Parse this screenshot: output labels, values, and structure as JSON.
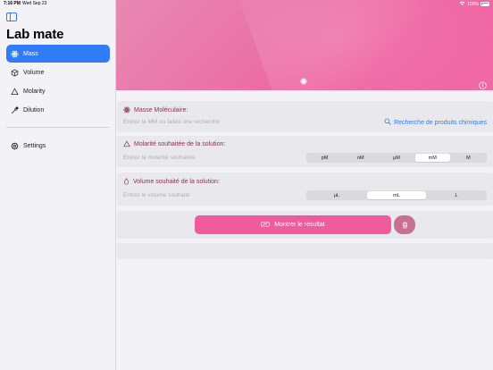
{
  "statusbar": {
    "time": "7:16 PM",
    "date": "Wed Sep 23",
    "battery": "100%"
  },
  "sidebar": {
    "title": "Lab mate",
    "items": [
      {
        "label": "Mass",
        "icon": "atom-icon",
        "active": true
      },
      {
        "label": "Volume",
        "icon": "cube-icon",
        "active": false
      },
      {
        "label": "Molarity",
        "icon": "triangle-icon",
        "active": false
      },
      {
        "label": "Dilution",
        "icon": "dropper-icon",
        "active": false
      }
    ],
    "settings_label": "Settings"
  },
  "mass_card": {
    "title": "Masse Moléculaire:",
    "placeholder": "Entrez la MM ou faites une recherche",
    "search_label": "Recherche de produits chimiques"
  },
  "molarity_card": {
    "title": "Molarité souhaitée de la solution:",
    "placeholder": "Entrez la molarité souhaitée",
    "units": [
      "pM",
      "nM",
      "µM",
      "mM",
      "M"
    ],
    "selected": "mM"
  },
  "volume_card": {
    "title": "Volume souhaité de la solution:",
    "placeholder": "Entrez le volume souhaité",
    "units": [
      "µL",
      "mL",
      "L"
    ],
    "selected": "mL"
  },
  "actions": {
    "show_result_label": "Montrer le résultat"
  },
  "colors": {
    "accent_blue": "#2f7cf6",
    "pink": "#ef5b9c",
    "title_maroon": "#8e2f56"
  }
}
